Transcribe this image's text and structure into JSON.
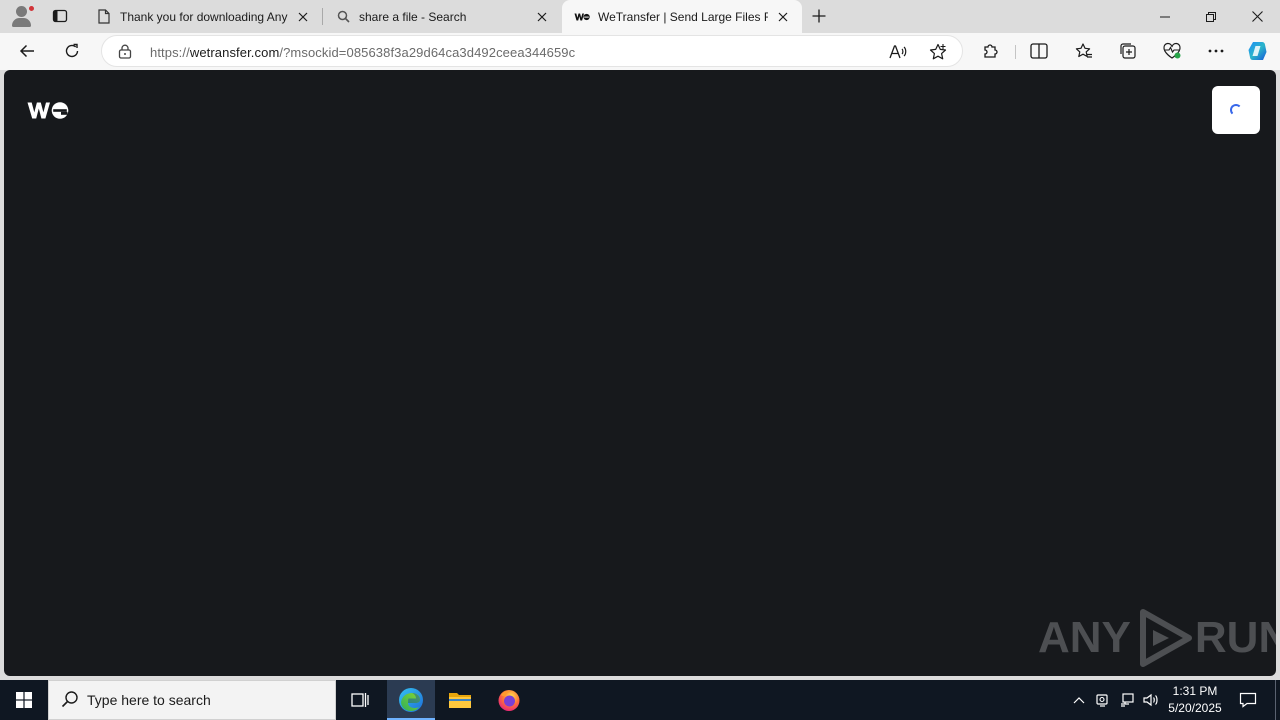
{
  "browser": {
    "tabs": [
      {
        "title": "Thank you for downloading AnyDesk",
        "icon": "document-icon",
        "active": false
      },
      {
        "title": "share a file - Search",
        "icon": "search-icon",
        "active": false
      },
      {
        "title": "WeTransfer | Send Large Files Fast",
        "icon": "wetransfer-icon",
        "active": true
      }
    ],
    "address": {
      "scheme": "https://",
      "host": "wetransfer.com",
      "path": "/?msockid=085638f3a29d64ca3d492ceea344659c"
    }
  },
  "page": {
    "background": "#17191c",
    "logo_text": "we",
    "watermark_left": "ANY",
    "watermark_right": "RUN",
    "spinner_color": "#3767ea"
  },
  "taskbar": {
    "search_placeholder": "Type here to search",
    "time": "1:31 PM",
    "date": "5/20/2025",
    "apps": [
      "task-view-icon",
      "edge-icon",
      "file-explorer-icon",
      "firefox-icon"
    ]
  }
}
